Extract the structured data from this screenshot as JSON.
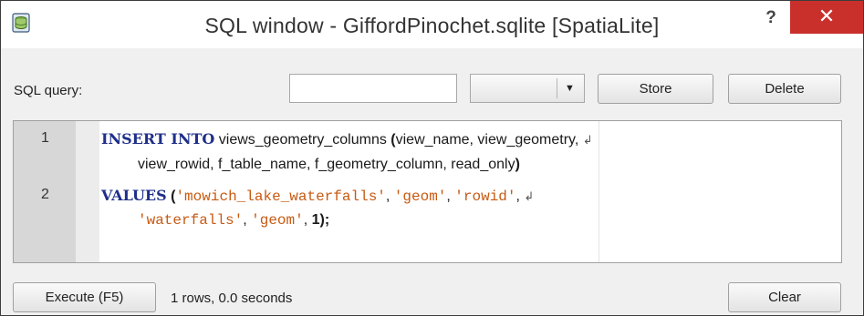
{
  "window": {
    "title": "SQL window - GiffordPinochet.sqlite [SpatiaLite]",
    "help_label": "?",
    "close_label": "✕",
    "accent_color": "#c9302c"
  },
  "toolbar": {
    "query_label": "SQL query:",
    "name_input_value": "",
    "stored_select_value": "",
    "store_label": "Store",
    "delete_label": "Delete"
  },
  "editor": {
    "line_numbers": [
      "1",
      "2"
    ],
    "line1_kw": "INSERT INTO",
    "line1_text": " views_geometry_columns ",
    "line1_paren": "(",
    "line1_rest": "view_name, view_geometry,",
    "line1_cont": "view_rowid, f_table_name, f_geometry_column, read_only",
    "line1_close": ")",
    "line2_kw": "VALUES",
    "line2_paren": "(",
    "line2_s1": "'mowich_lake_waterfalls'",
    "line2_s2": "'geom'",
    "line2_s3": "'rowid'",
    "line2_s4": "'waterfalls'",
    "line2_s5": "'geom'",
    "line2_num": "1",
    "line2_close": ");",
    "comma": ", ",
    "wrap_glyph": "↲"
  },
  "footer": {
    "execute_label": "Execute (F5)",
    "status_text": "1 rows, 0.0 seconds",
    "clear_label": "Clear"
  }
}
